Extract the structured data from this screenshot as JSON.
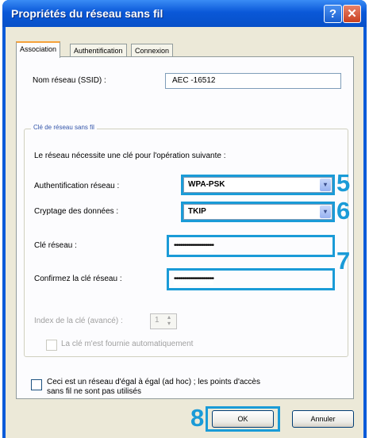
{
  "window": {
    "title": "Propriétés du réseau sans fil",
    "help_glyph": "?",
    "close_glyph": "✕"
  },
  "tabs": [
    {
      "label": "Association",
      "active": true
    },
    {
      "label": "Authentification",
      "active": false
    },
    {
      "label": "Connexion",
      "active": false
    }
  ],
  "network_name": {
    "label": "Nom réseau (SSID) :",
    "value": "AEC -16512"
  },
  "wireless_key_group": {
    "legend": "Clé de réseau sans fil",
    "description": "Le réseau nécessite une clé pour l'opération suivante :",
    "authentication": {
      "label": "Authentification réseau :",
      "value": "WPA-PSK"
    },
    "encryption": {
      "label": "Cryptage des données :",
      "value": "TKIP"
    },
    "network_key": {
      "label": "Clé réseau :",
      "value": "••••••••••••••••••••"
    },
    "confirm_key": {
      "label": "Confirmez la clé réseau :",
      "value": "••••••••••••••••••••"
    },
    "key_index": {
      "label": "Index de la clé (avancé) :",
      "value": "1"
    },
    "auto_key": {
      "label": "La clé m'est fournie automatiquement"
    }
  },
  "adhoc": {
    "label_line1": "Ceci est un réseau d'égal à égal (ad hoc) ; les points d'accès",
    "label_line2": "sans fil ne sont pas utilisés"
  },
  "buttons": {
    "ok": "OK",
    "cancel": "Annuler"
  },
  "callouts": {
    "authentication": "5",
    "encryption": "6",
    "keys": "7",
    "ok": "8"
  },
  "colors": {
    "callout": "#1a9bd7",
    "title_bar": "#0a58d8",
    "dialog": "#ece9d8"
  },
  "icons": {
    "dropdown": "▾",
    "spin_up": "▴",
    "spin_down": "▾"
  }
}
